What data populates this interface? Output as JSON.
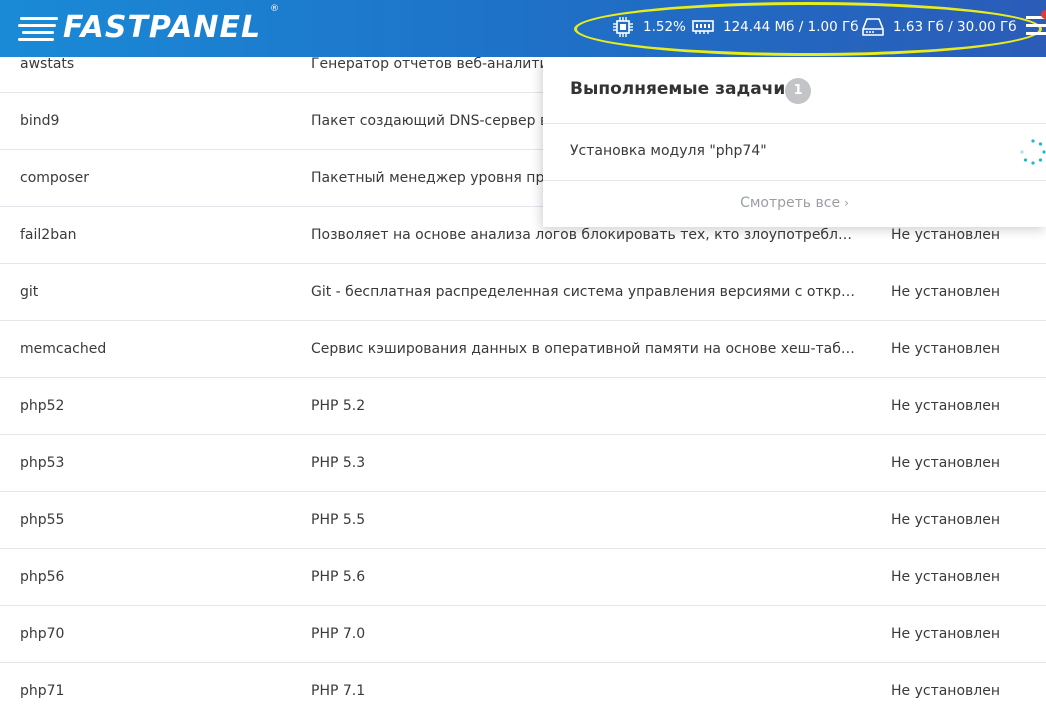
{
  "header": {
    "logo_text": "FASTPANEL",
    "logo_mark": "®",
    "cpu": "1.52%",
    "ram": "124.44 Мб / 1.00 Гб",
    "disk": "1.63 Гб / 30.00 Гб"
  },
  "tasks_popup": {
    "title": "Выполняемые задачи",
    "count": "1",
    "task": "Установка модуля \"php74\"",
    "view_all": "Смотреть все",
    "view_all_chevron": "›"
  },
  "table": {
    "rows": [
      {
        "name": "awstats",
        "description": "Генератор отчетов веб-аналитики",
        "status": ""
      },
      {
        "name": "bind9",
        "description": "Пакет создающий DNS-сервер в ло",
        "status": ""
      },
      {
        "name": "composer",
        "description": "Пакетный менеджер уровня прил",
        "status": ""
      },
      {
        "name": "fail2ban",
        "description": "Позволяет на основе анализа логов блокировать тех, кто злоупотребляет до...",
        "status": "Не установлен"
      },
      {
        "name": "git",
        "description": "Git - бесплатная распределенная система управления версиями с открытым ...",
        "status": "Не установлен"
      },
      {
        "name": "memcached",
        "description": "Сервис кэширования данных в оперативной памяти на основе хеш-таблицы.",
        "status": "Не установлен"
      },
      {
        "name": "php52",
        "description": "PHP 5.2",
        "status": "Не установлен"
      },
      {
        "name": "php53",
        "description": "PHP 5.3",
        "status": "Не установлен"
      },
      {
        "name": "php55",
        "description": "PHP 5.5",
        "status": "Не установлен"
      },
      {
        "name": "php56",
        "description": "PHP 5.6",
        "status": "Не установлен"
      },
      {
        "name": "php70",
        "description": "PHP 7.0",
        "status": "Не установлен"
      },
      {
        "name": "php71",
        "description": "PHP 7.1",
        "status": "Не установлен"
      }
    ]
  },
  "colors": {
    "header_start": "#1a8ad6",
    "header_end": "#2a5cb8",
    "highlight_ellipse": "#e8ec1c",
    "spinner": "#1fb5d4",
    "notification_dot": "#e53935"
  },
  "icons": {
    "cpu": "cpu-icon",
    "ram": "memory-icon",
    "disk": "hard-drive-icon",
    "menu": "hamburger-menu-icon",
    "spinner": "loading-spinner-icon"
  }
}
